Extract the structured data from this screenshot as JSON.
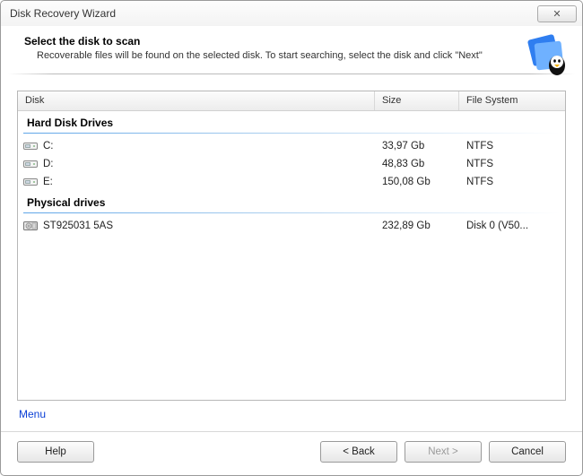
{
  "window": {
    "title": "Disk Recovery Wizard",
    "close_glyph": "✕"
  },
  "header": {
    "title": "Select the disk to scan",
    "description": "Recoverable files will be found on the selected disk. To start searching, select the disk and click \"Next\""
  },
  "columns": {
    "disk": "Disk",
    "size": "Size",
    "fs": "File System"
  },
  "groups": [
    {
      "name": "Hard Disk Drives",
      "icon": "drive-icon",
      "rows": [
        {
          "disk": "C:",
          "size": "33,97 Gb",
          "fs": "NTFS"
        },
        {
          "disk": "D:",
          "size": "48,83 Gb",
          "fs": "NTFS"
        },
        {
          "disk": "E:",
          "size": "150,08 Gb",
          "fs": "NTFS"
        }
      ]
    },
    {
      "name": "Physical drives",
      "icon": "physical-drive-icon",
      "rows": [
        {
          "disk": "ST925031 5AS",
          "size": "232,89 Gb",
          "fs": "Disk 0 (V50..."
        }
      ]
    }
  ],
  "menu": {
    "label": "Menu"
  },
  "buttons": {
    "help": "Help",
    "back": "< Back",
    "next": "Next >",
    "cancel": "Cancel",
    "next_enabled": false
  }
}
